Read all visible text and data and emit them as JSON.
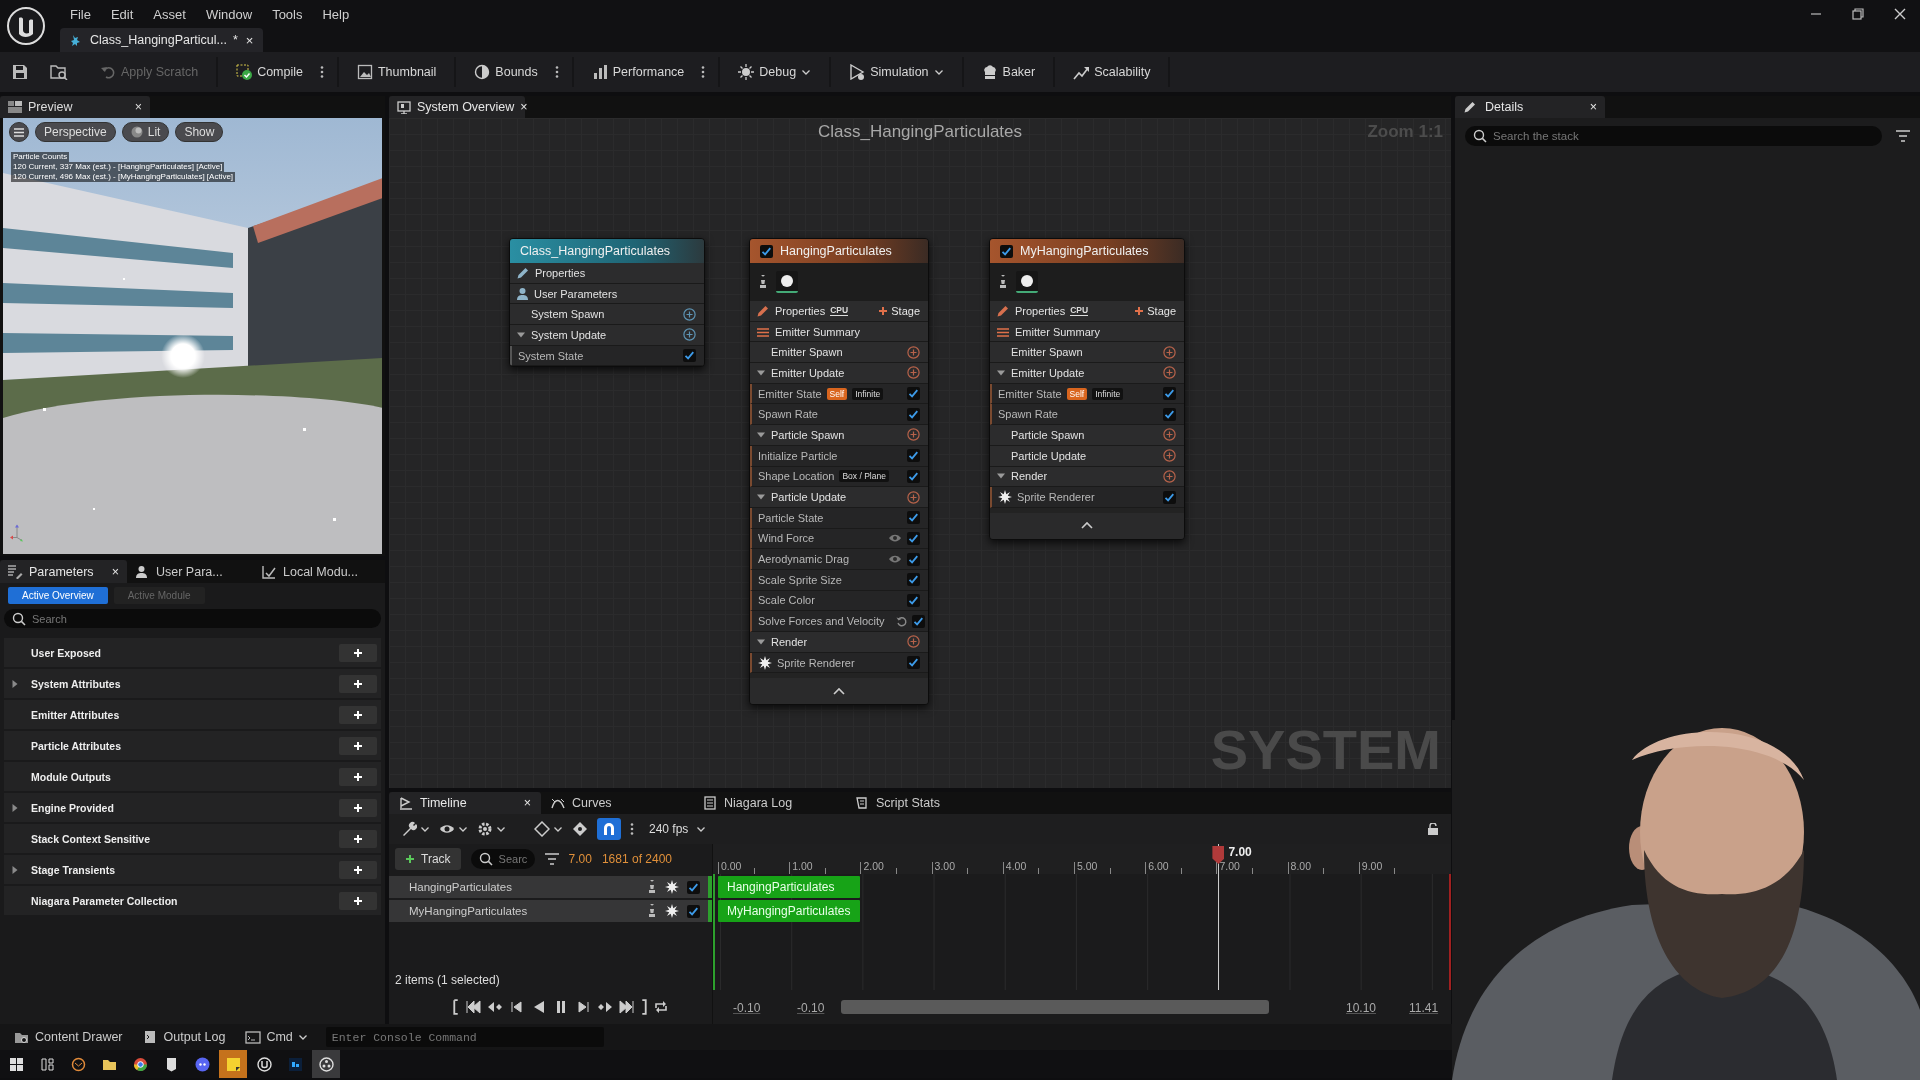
{
  "menu": [
    "File",
    "Edit",
    "Asset",
    "Window",
    "Tools",
    "Help"
  ],
  "document_tab": {
    "label": "Class_HangingParticul...",
    "modified": "*",
    "close": "×"
  },
  "toolbar": [
    {
      "label": "Apply Scratch",
      "disabled": true,
      "kind": "plain"
    },
    {
      "label": "Compile",
      "disabled": false,
      "kind": "more"
    },
    {
      "label": "Thumbnail",
      "disabled": false,
      "kind": "plain"
    },
    {
      "label": "Bounds",
      "disabled": false,
      "kind": "more"
    },
    {
      "label": "Performance",
      "disabled": false,
      "kind": "more"
    },
    {
      "label": "Debug",
      "disabled": false,
      "kind": "dropdown"
    },
    {
      "label": "Simulation",
      "disabled": false,
      "kind": "dropdown"
    },
    {
      "label": "Baker",
      "disabled": false,
      "kind": "plain"
    },
    {
      "label": "Scalability",
      "disabled": false,
      "kind": "plain"
    }
  ],
  "preview": {
    "tab": "Preview",
    "close": "×",
    "viewport_buttons": [
      "Perspective",
      "Lit",
      "Show"
    ],
    "stats": [
      "Particle Counts",
      "120 Current, 337 Max (est.) - [HangingParticulates] [Active]",
      "120 Current, 496 Max (est.) - [MyHangingParticulates] [Active]"
    ],
    "viewport": {
      "kind": "picture"
    }
  },
  "parameters": {
    "tabs": [
      {
        "label": "Parameters",
        "selected": true,
        "close": "×"
      },
      {
        "label": "User Para...",
        "selected": false
      },
      {
        "label": "Local Modu...",
        "selected": false
      }
    ],
    "modes": [
      {
        "label": "Active Overview",
        "selected": true
      },
      {
        "label": "Active Module",
        "selected": false
      }
    ],
    "search": {
      "placeholder": "Search"
    },
    "categories": [
      {
        "label": "User Exposed",
        "expandable": false
      },
      {
        "label": "System Attributes",
        "expandable": true
      },
      {
        "label": "Emitter Attributes",
        "expandable": false
      },
      {
        "label": "Particle Attributes",
        "expandable": false
      },
      {
        "label": "Module Outputs",
        "expandable": false
      },
      {
        "label": "Engine Provided",
        "expandable": true
      },
      {
        "label": "Stack Context Sensitive",
        "expandable": false
      },
      {
        "label": "Stage Transients",
        "expandable": true
      },
      {
        "label": "Niagara Parameter Collection",
        "expandable": false
      }
    ]
  },
  "graph": {
    "tab": "System Overview",
    "close": "×",
    "title": "Class_HangingParticulates",
    "zoom": "Zoom 1:1",
    "corner_label": "SYSTEM",
    "nodes": [
      {
        "kind": "system",
        "title": "Class_HangingParticulates",
        "rows": [
          {
            "kind": "properties",
            "label": "Properties"
          },
          {
            "kind": "parameters",
            "label": "User Parameters"
          },
          {
            "kind": "group",
            "label": "System Spawn"
          },
          {
            "kind": "group",
            "label": "System Update",
            "expanded": true
          },
          {
            "kind": "module",
            "label": "System State",
            "enabled": true
          }
        ]
      },
      {
        "kind": "emitter",
        "title": "HangingParticulates",
        "enabled": true,
        "rows": [
          {
            "kind": "properties",
            "label": "Properties",
            "badge": "CPU",
            "action": "Stage"
          },
          {
            "kind": "summary",
            "label": "Emitter Summary"
          },
          {
            "kind": "group",
            "label": "Emitter Spawn"
          },
          {
            "kind": "group",
            "label": "Emitter Update",
            "expanded": true
          },
          {
            "kind": "module",
            "label": "Emitter State",
            "enabled": true,
            "tags": [
              {
                "text": "Self",
                "kind": "scope"
              },
              {
                "text": "Infinite",
                "kind": "value"
              }
            ]
          },
          {
            "kind": "module",
            "label": "Spawn Rate",
            "enabled": true
          },
          {
            "kind": "group",
            "label": "Particle Spawn",
            "expanded": true
          },
          {
            "kind": "module",
            "label": "Initialize Particle",
            "enabled": true
          },
          {
            "kind": "module",
            "label": "Shape Location",
            "enabled": true,
            "tags": [
              {
                "text": "Box / Plane",
                "kind": "value"
              }
            ]
          },
          {
            "kind": "group",
            "label": "Particle Update",
            "expanded": true
          },
          {
            "kind": "module",
            "label": "Particle State",
            "enabled": true
          },
          {
            "kind": "module",
            "label": "Wind Force",
            "enabled": true,
            "visible": true
          },
          {
            "kind": "module",
            "label": "Aerodynamic Drag",
            "enabled": true,
            "visible": true
          },
          {
            "kind": "module",
            "label": "Scale Sprite Size",
            "enabled": true
          },
          {
            "kind": "module",
            "label": "Scale Color",
            "enabled": true
          },
          {
            "kind": "module",
            "label": "Solve Forces and Velocity",
            "enabled": true,
            "reset": true
          },
          {
            "kind": "group",
            "label": "Render",
            "expanded": true
          },
          {
            "kind": "renderer",
            "label": "Sprite Renderer",
            "enabled": true
          }
        ]
      },
      {
        "kind": "emitter",
        "title": "MyHangingParticulates",
        "enabled": true,
        "rows": [
          {
            "kind": "properties",
            "label": "Properties",
            "badge": "CPU",
            "action": "Stage"
          },
          {
            "kind": "summary",
            "label": "Emitter Summary"
          },
          {
            "kind": "group",
            "label": "Emitter Spawn"
          },
          {
            "kind": "group",
            "label": "Emitter Update",
            "expanded": true
          },
          {
            "kind": "module",
            "label": "Emitter State",
            "enabled": true,
            "tags": [
              {
                "text": "Self",
                "kind": "scope"
              },
              {
                "text": "Infinite",
                "kind": "value"
              }
            ]
          },
          {
            "kind": "module",
            "label": "Spawn Rate",
            "enabled": true
          },
          {
            "kind": "group",
            "label": "Particle Spawn"
          },
          {
            "kind": "group",
            "label": "Particle Update"
          },
          {
            "kind": "group",
            "label": "Render",
            "expanded": true
          },
          {
            "kind": "renderer",
            "label": "Sprite Renderer",
            "enabled": true
          }
        ]
      }
    ]
  },
  "details": {
    "tab": "Details",
    "close": "×",
    "search": {
      "placeholder": "Search the stack"
    }
  },
  "timeline": {
    "tabs": [
      {
        "label": "Timeline",
        "selected": true,
        "close": "×"
      },
      {
        "label": "Curves",
        "selected": false
      },
      {
        "label": "Niagara Log",
        "selected": false
      },
      {
        "label": "Script Stats",
        "selected": false
      }
    ],
    "snap": true,
    "fps": "240 fps",
    "add_track": "Track",
    "search": {
      "placeholder": "Searc"
    },
    "current_time": "7.00",
    "frame": "1681 of 2400",
    "ruler": [
      "0.00",
      "1.00",
      "2.00",
      "3.00",
      "4.00",
      "5.00",
      "6.00",
      "7.00",
      "8.00",
      "9.00"
    ],
    "playhead": "7.00",
    "tracks": [
      {
        "name": "HangingParticulates",
        "enabled": true,
        "clip": "HangingParticulates"
      },
      {
        "name": "MyHangingParticulates",
        "enabled": true,
        "clip": "MyHangingParticulates"
      }
    ],
    "status": "2 items (1 selected)",
    "range": [
      "-0.10",
      "-0.10",
      "10.10",
      "11.41"
    ]
  },
  "status_bar": {
    "items": [
      {
        "label": "Content Drawer",
        "dropdown": false
      },
      {
        "label": "Output Log",
        "dropdown": false
      },
      {
        "label": "Cmd",
        "dropdown": true
      }
    ],
    "console": {
      "placeholder": "Enter Console Command"
    }
  },
  "webcam": {
    "kind": "picture"
  }
}
